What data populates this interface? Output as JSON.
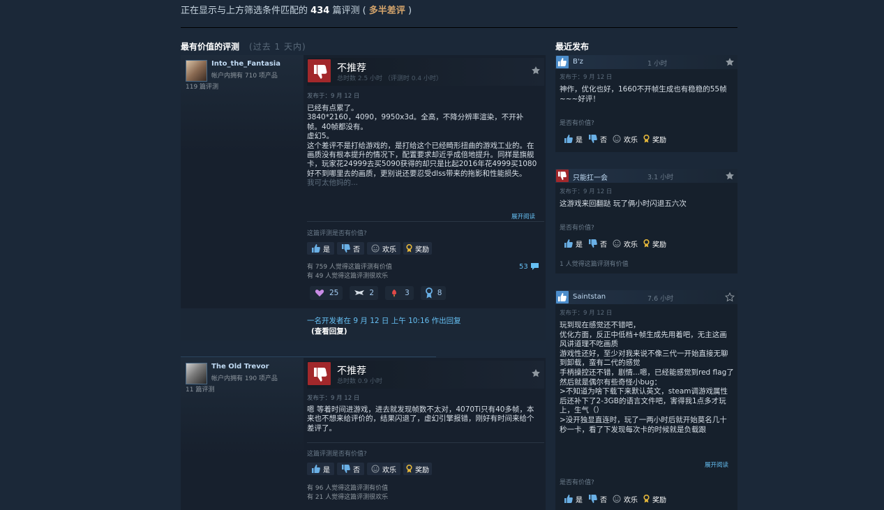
{
  "summary": {
    "prefix": "正在显示与上方筛选条件匹配的",
    "count": "434",
    "suffix": "篇评测 (",
    "rating": "多半差评",
    "close": ")"
  },
  "sections": {
    "helpful_title": "最有价值的评测",
    "helpful_period": "(过去 1 天内)",
    "recent_title": "最近发布"
  },
  "colors": {
    "accent": "#66c0f4",
    "negative": "#a2282b",
    "positive": "#4c8dcb",
    "mixed": "#d2a36b"
  },
  "reviews": [
    {
      "author": "Into_the_Fantasia",
      "owned": "帐户内拥有 710 项产品",
      "reviews_count": "119 篇评测",
      "verdict": "不推荐",
      "hours": "总时数 2.5 小时 （评测时 0.4 小时）",
      "posted": "发布于：9 月 12 日",
      "body": [
        "已经有点累了。",
        "3840*2160，4090，9950x3d。全高，不降分辨率渲染，不开补帧。40帧都没有。",
        "虚幻5。",
        "这个差评不是打给游戏的，是打给这个已经畸形扭曲的游戏工业的。在画质没有根本提升的情况下，配置要求却近乎成倍地提升。同样是旗舰卡，玩家花24999去买5090获得的却只是比起2016年花4999买1080好不到哪里去的画质，更别说还要忍受dlss带来的拖影和性能损失。",
        "我可太他妈的..."
      ],
      "read_more": "展开阅读",
      "helpful_question": "这篇评测是否有价值?",
      "buttons": {
        "yes": "是",
        "no": "否",
        "funny": "欢乐",
        "award": "奖励"
      },
      "found_helpful": "有 759 人觉得这篇评测有价值",
      "found_funny": "有 49 人觉得这篇评测很欢乐",
      "comments": "53",
      "awards": [
        "25",
        "2",
        "3",
        "8"
      ]
    },
    {
      "author": "The Old Trevor",
      "owned": "帐户内拥有 190 项产品",
      "reviews_count": "11 篇评测",
      "verdict": "不推荐",
      "hours": "总时数 0.9 小时",
      "posted": "发布于：9 月 12 日",
      "body": [
        "嗯 等着时间进游戏，进去就发现帧数不太对，4070Ti只有40多帧，本来也不想来给评价的，结果闪退了，虚幻引擎报错，刚好有时间来给个差评了。"
      ],
      "helpful_question": "这篇评测是否有价值?",
      "buttons": {
        "yes": "是",
        "no": "否",
        "funny": "欢乐",
        "award": "奖励"
      },
      "found_helpful": "有 96 人觉得这篇评测有价值",
      "found_funny": "有 21 人觉得这篇评测很欢乐"
    }
  ],
  "developer_reply": {
    "text": "一名开发者在 9 月 12 日 上午 10:16 作出回复",
    "link": "(查看回复)"
  },
  "recent": [
    {
      "author": "B'z",
      "hours": "1 小时",
      "recommended": true,
      "posted": "发布于：9 月 12 日",
      "body": "神作，优化也好，1660不开帧生成也有稳稳的55帧~~~好评！",
      "helpful_question": "是否有价值?",
      "buttons": {
        "yes": "是",
        "no": "否",
        "funny": "欢乐",
        "award": "奖励"
      }
    },
    {
      "author": "只能扛一会",
      "hours": "3.1 小时",
      "recommended": false,
      "posted": "发布于：9 月 12 日",
      "body": "这游戏来回翻跶 玩了俩小时闪退五六次",
      "helpful_question": "是否有价值?",
      "buttons": {
        "yes": "是",
        "no": "否",
        "funny": "欢乐",
        "award": "奖励"
      },
      "found_helpful": "1 人觉得这篇评测有价值"
    },
    {
      "author": "Saintstan",
      "hours": "7.6 小时",
      "recommended": true,
      "posted": "发布于：9 月 12 日",
      "body": "玩到现在感觉还不错吧，\n优化方面，反正中低档+帧生成先用着吧，无主这画风讲道理不吃画质\n游戏性还好，至少对我来说不像三代一开始直接无聊到卸载，蛮有二代的感觉\n手柄操控还不错，剧情...嗯，已经能感觉到red flag了\n然后就是偶尔有些奇怪小bug：\n>不知道为啥下载下来默认英文，steam调游戏属性后还补下了2-3GB的语言文件吧，害得我1点多才玩上，生气（）\n>没开独显直连时，玩了一两小时后就开始莫名几十秒一卡，看了下发现每次卡的时候就是负载跟",
      "read_more": "展开阅读",
      "helpful_question": "是否有价值?",
      "buttons": {
        "yes": "是",
        "no": "否",
        "funny": "欢乐",
        "award": "奖励"
      }
    }
  ]
}
